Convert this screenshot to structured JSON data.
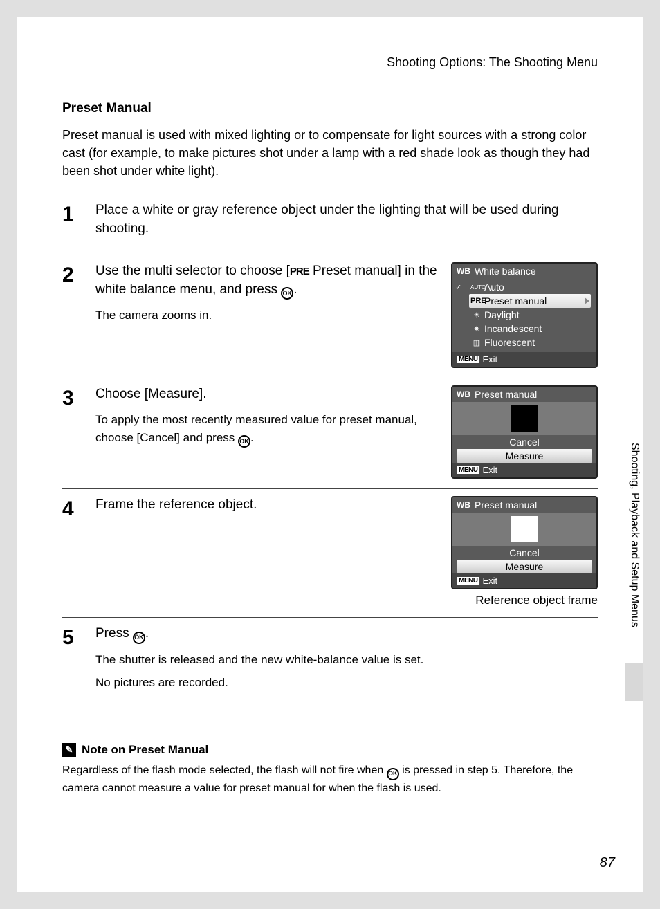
{
  "header": "Shooting Options: The Shooting Menu",
  "section_title": "Preset Manual",
  "intro": "Preset manual is used with mixed lighting or to compensate for light sources with a strong color cast (for example, to make pictures shot under a lamp with a red shade look as though they had been shot under white light).",
  "steps": {
    "s1": {
      "num": "1",
      "main": "Place a white or gray reference object under the lighting that will be used during shooting."
    },
    "s2": {
      "num": "2",
      "main_a": "Use the multi selector to choose [",
      "main_b": " Preset manual] in the white balance menu, and press ",
      "main_c": ".",
      "sub": "The camera zooms in."
    },
    "s3": {
      "num": "3",
      "main": "Choose [Measure].",
      "sub_a": "To apply the most recently measured value for preset manual, choose [Cancel] and press ",
      "sub_b": "."
    },
    "s4": {
      "num": "4",
      "main": "Frame the reference object.",
      "ref_label": "Reference object frame"
    },
    "s5": {
      "num": "5",
      "main_a": "Press ",
      "main_b": ".",
      "sub1": "The shutter is released and the new white-balance value is set.",
      "sub2": "No pictures are recorded."
    }
  },
  "lcd1": {
    "title": "White balance",
    "items": {
      "auto": "Auto",
      "preset": "Preset manual",
      "daylight": "Daylight",
      "incandescent": "Incandescent",
      "fluorescent": "Fluorescent"
    },
    "exit": "Exit"
  },
  "lcd2": {
    "title": "Preset manual",
    "cancel": "Cancel",
    "measure": "Measure",
    "exit": "Exit"
  },
  "lcd3": {
    "title": "Preset manual",
    "cancel": "Cancel",
    "measure": "Measure",
    "exit": "Exit"
  },
  "note": {
    "title": "Note on Preset Manual",
    "body_a": "Regardless of the flash mode selected, the flash will not fire when ",
    "body_b": " is pressed in step 5. Therefore, the camera cannot measure a value for preset manual for when the flash is used."
  },
  "side_tab": "Shooting, Playback and Setup Menus",
  "page_num": "87",
  "icons": {
    "wb": "WB",
    "auto": "AUTO",
    "pre": "PRE",
    "menu": "MENU",
    "ok": "OK",
    "pencil": "✎"
  }
}
